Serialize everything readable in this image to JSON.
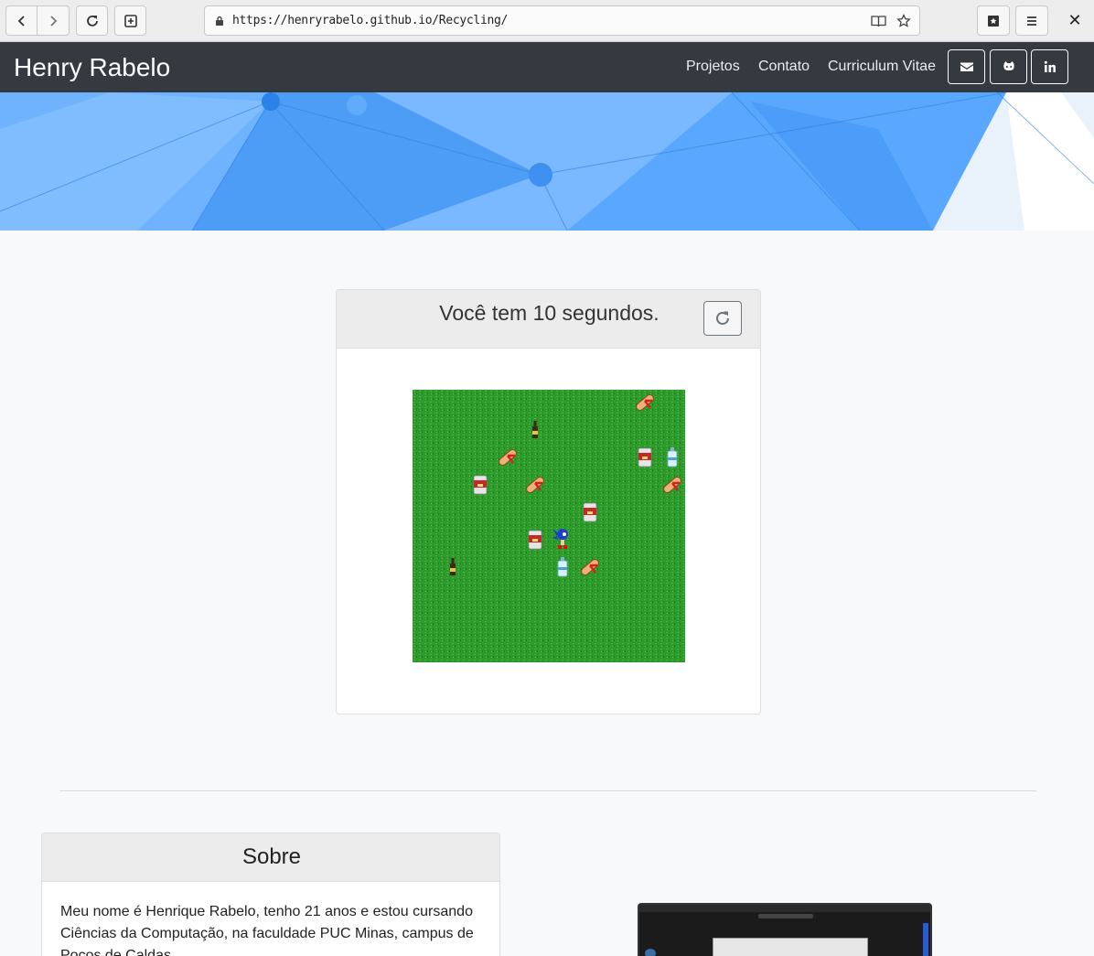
{
  "browser": {
    "url": "https://henryrabelo.github.io/Recycling/",
    "close_glyph": "✕"
  },
  "navbar": {
    "brand": "Henry Rabelo",
    "links": [
      "Projetos",
      "Contato",
      "Curriculum Vitae"
    ],
    "social_icons": [
      "envelope-icon",
      "github-icon",
      "linkedin-icon"
    ]
  },
  "game": {
    "title": "Você tem 10 segundos.",
    "sprites": [
      "scroll",
      "bottle",
      "scroll",
      "can",
      "can",
      "scroll",
      "water-bottle",
      "scroll",
      "can",
      "can",
      "sonic",
      "bottle",
      "water-bottle",
      "scroll"
    ]
  },
  "about": {
    "title": "Sobre",
    "text": "Meu nome é Henrique Rabelo, tenho 21 anos e estou cursando Ciências da Computação, na faculdade PUC Minas, campus de Poços de Caldas."
  },
  "colors": {
    "navbar": "#343a40",
    "hero": "#5aa7ff",
    "grass": "#2e9a2c",
    "page_bg": "#f8f9fa"
  }
}
